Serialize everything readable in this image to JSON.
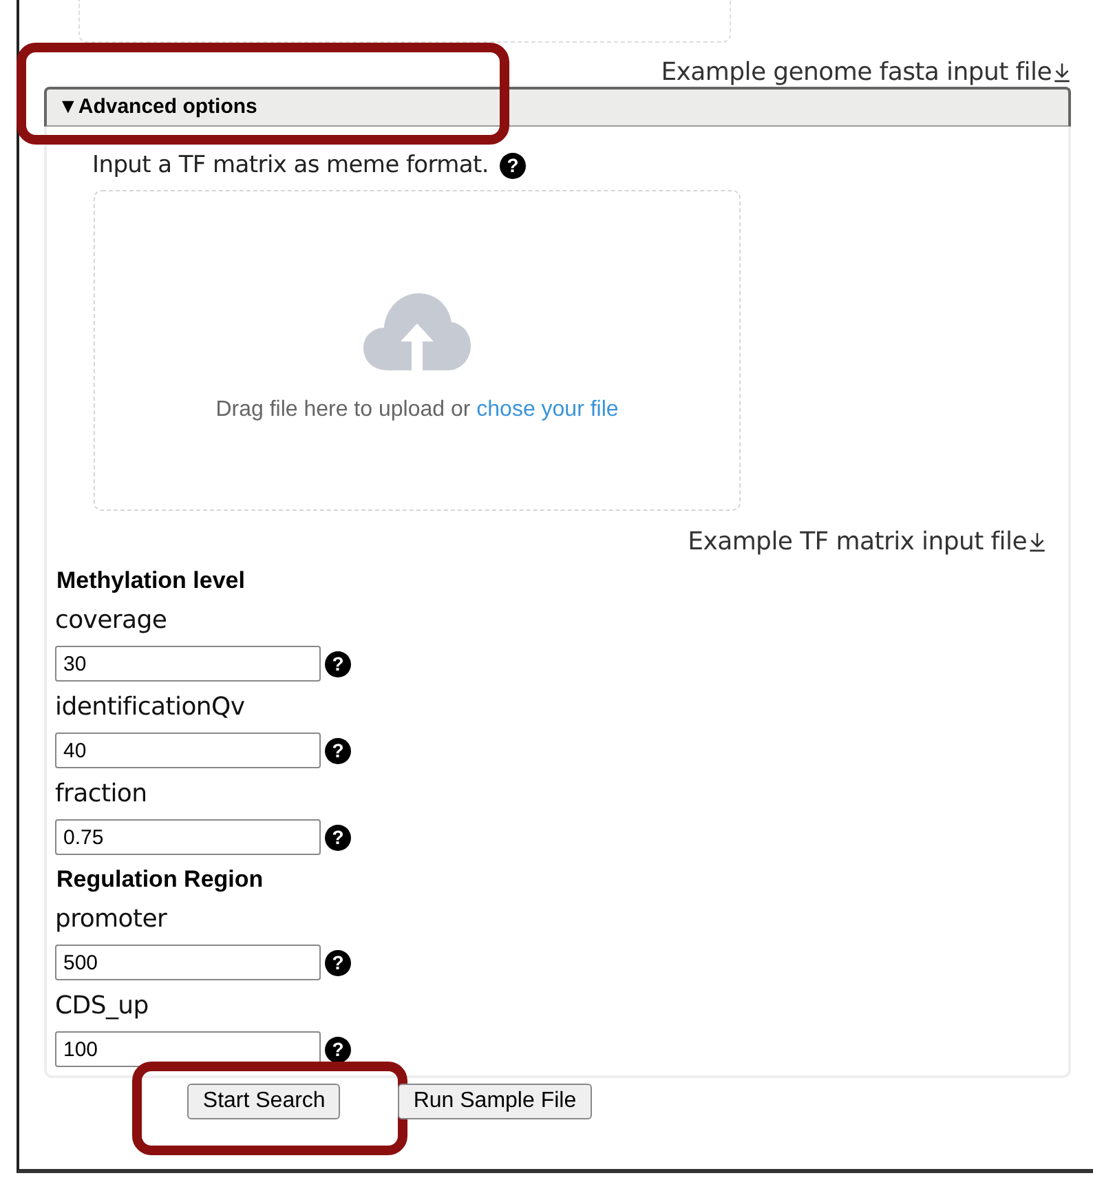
{
  "genome_upload": {
    "example_link": "Example genome fasta input file"
  },
  "advanced": {
    "marker": "▼",
    "summary": "Advanced options",
    "expanded": true,
    "highlighted": true,
    "matrix_upload": {
      "prompt": "Input a TF matrix as meme format.",
      "help": "?",
      "drop_text": "Drag file here to upload or ",
      "choose_link": "chose your file",
      "example_link": "Example TF matrix input file"
    },
    "sections": [
      {
        "heading": "Methylation level",
        "fields": [
          {
            "label": "coverage",
            "value": "30",
            "help": "?"
          },
          {
            "label": "identificationQv",
            "value": "40",
            "help": "?"
          },
          {
            "label": "fraction",
            "value": "0.75",
            "help": "?"
          }
        ]
      },
      {
        "heading": "Regulation Region",
        "fields": [
          {
            "label": "promoter",
            "value": "500",
            "help": "?"
          },
          {
            "label": "CDS_up",
            "value": "100",
            "help": "?"
          }
        ]
      }
    ]
  },
  "buttons": [
    {
      "label": "Start Search",
      "highlighted": true
    },
    {
      "label": "Run Sample File",
      "highlighted": false
    }
  ]
}
